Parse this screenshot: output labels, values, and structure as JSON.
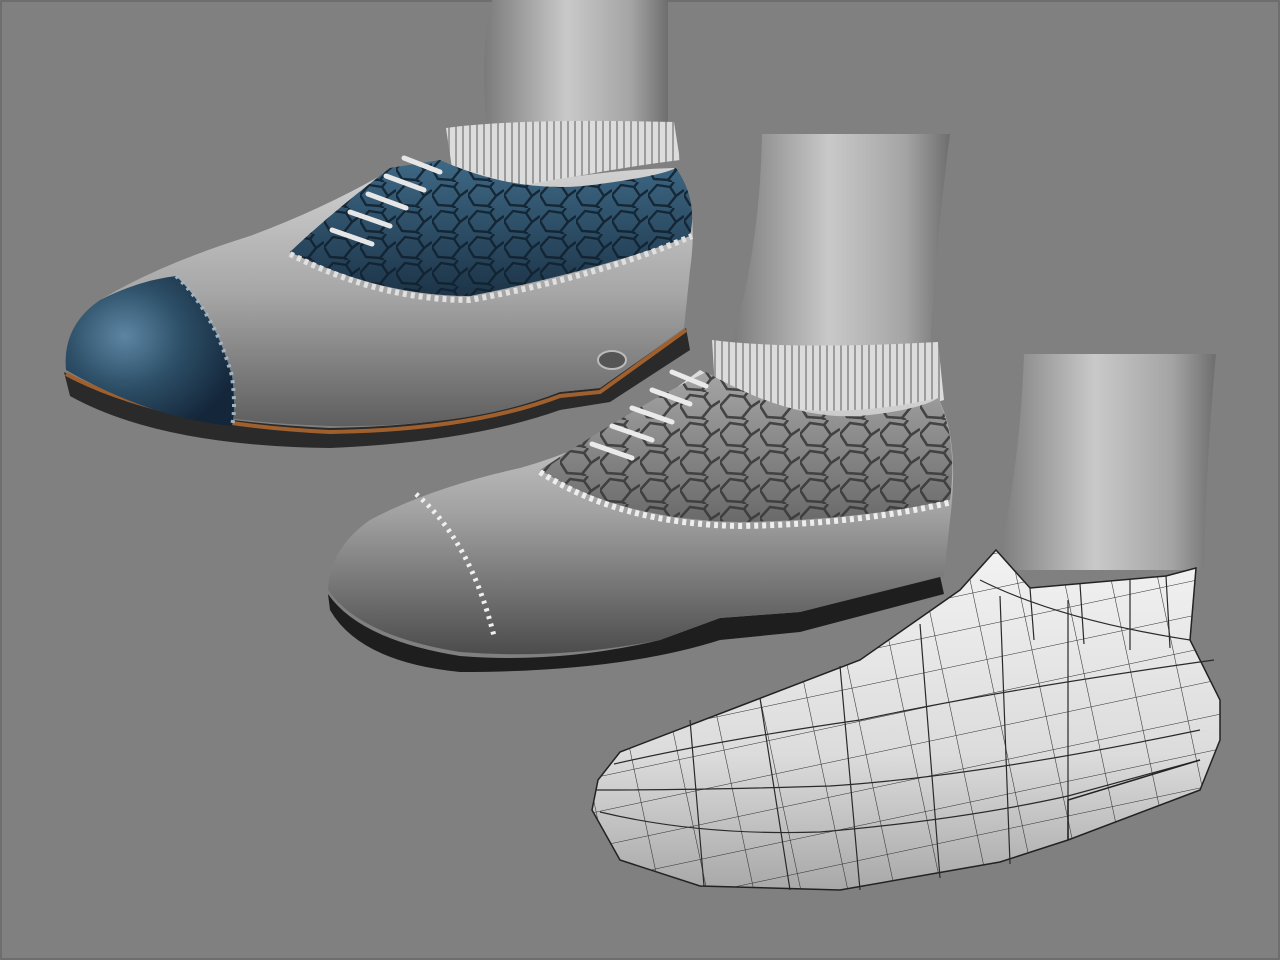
{
  "scene": {
    "background_color": "#808080",
    "border_color": "#6e6e6e",
    "models": [
      {
        "name": "textured-colored-shoe",
        "colors": {
          "toe_cap": "#2c4e66",
          "upper": "#a9a9a9",
          "sole_trim": "#a0602e",
          "sock": "#cfcfcf"
        }
      },
      {
        "name": "grayscale-shaded-shoe",
        "colors": {
          "upper": "#9a9a9a",
          "pattern": "#555555",
          "sock": "#d8d8d8"
        }
      },
      {
        "name": "wireframe-shoe",
        "colors": {
          "surface": "#e6e6e6",
          "wire": "#333333"
        }
      }
    ]
  }
}
